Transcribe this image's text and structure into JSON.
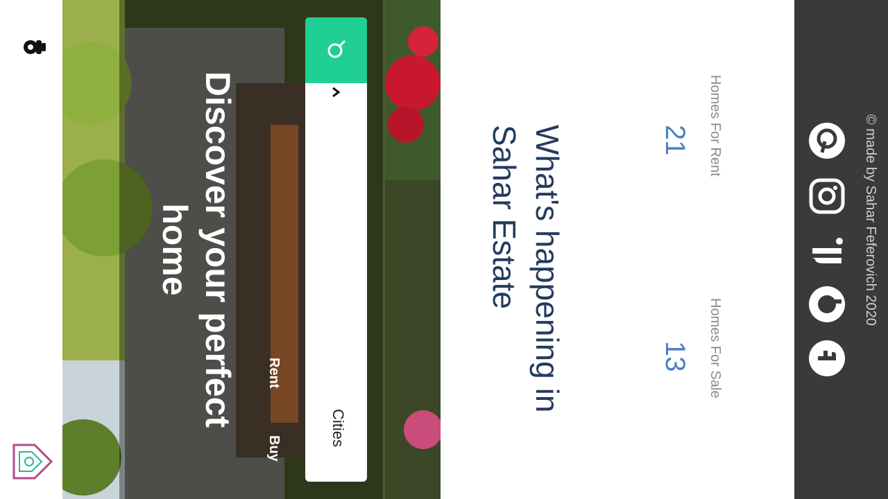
{
  "nav": {
    "user_icon": "user-icon",
    "logo_icon": "house-logo-icon"
  },
  "hero": {
    "title": "Discover your perfect home",
    "tabs": {
      "buy": "Buy",
      "rent": "Rent"
    },
    "search": {
      "button_icon": "search-icon",
      "dropdown_icon": "chevron-down-icon",
      "select_value": "Cities"
    },
    "accent_color": "#1fcf93"
  },
  "info": {
    "heading": "What's happening in Sahar Estate",
    "stats": [
      {
        "count": "21",
        "label": "Homes For Rent"
      },
      {
        "count": "13",
        "label": "Homes For Sale"
      }
    ]
  },
  "footer": {
    "social_icons": [
      "pinterest-icon",
      "instagram-icon",
      "linkedin-icon",
      "github-icon",
      "facebook-icon"
    ],
    "copyright": "© made by Sahar Feferovich 2020"
  }
}
